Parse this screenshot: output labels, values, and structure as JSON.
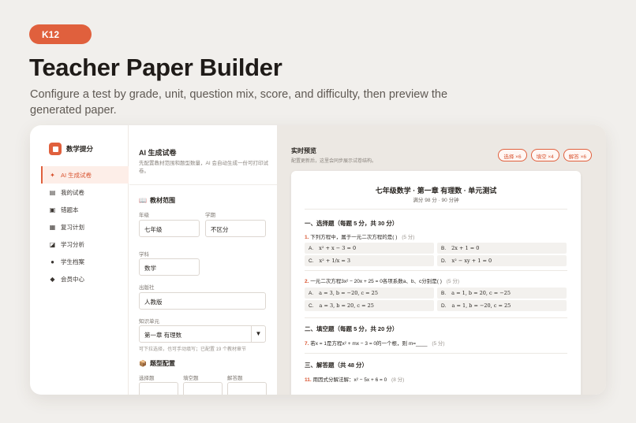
{
  "header": {
    "tag": "K12",
    "title": "Teacher Paper Builder",
    "subtitle": "Configure a test by grade, unit, question mix, score, and difficulty, then preview the generated paper."
  },
  "sidebar": {
    "brand": "数学提分",
    "items": [
      {
        "label": "AI 生成试卷",
        "icon": "sparkle-icon",
        "glyph": "✦"
      },
      {
        "label": "我的试卷",
        "icon": "document-icon",
        "glyph": "▤"
      },
      {
        "label": "错题本",
        "icon": "book-icon",
        "glyph": "▣"
      },
      {
        "label": "复习计划",
        "icon": "calendar-icon",
        "glyph": "▦"
      },
      {
        "label": "学习分析",
        "icon": "chart-icon",
        "glyph": "◪"
      },
      {
        "label": "学生档案",
        "icon": "user-icon",
        "glyph": "●"
      },
      {
        "label": "会员中心",
        "icon": "diamond-icon",
        "glyph": "◆"
      }
    ]
  },
  "form": {
    "title": "AI 生成试卷",
    "description": "先配置教材范围和题型数量，AI 会自动生成一份可打印试卷。",
    "scope_section": "教材范围",
    "grade_label": "年级",
    "grade_value": "七年级",
    "term_label": "学期",
    "term_value": "不区分",
    "subject_label": "学科",
    "subject_value": "数学",
    "publisher_label": "出版社",
    "publisher_value": "人教版",
    "unit_label": "知识单元",
    "unit_value": "第一章 有理数",
    "unit_hint": "可下拉选择，也可手动填写；已配置 19 个教材章节",
    "types_section": "题型配置",
    "type_labels": [
      "选择题",
      "填空题",
      "解答题"
    ]
  },
  "preview": {
    "title": "实时预览",
    "description": "配置更新后，这里会同步展示试卷结构。",
    "chips": [
      "选择 ×6",
      "填空 ×4",
      "解答 ×6"
    ],
    "paper": {
      "title": "七年级数学 · 第一章 有理数 · 单元测试",
      "meta": "满分 98 分 · 90 分钟",
      "sections": [
        "一、选择题（每题 5 分，共 30 分）",
        "二、填空题（每题 5 分，共 20 分）",
        "三、解答题（共 48 分）"
      ],
      "questions": [
        {
          "num": "1.",
          "text": "下列方程中，属于一元二次方程的是(        )",
          "points": "(5 分)",
          "options": [
            "A.|x² + x − 3 = 0",
            "B.|2x + 1 = 0",
            "C.|x² + 1/x = 3",
            "D.|x² − xy + 1 = 0"
          ]
        },
        {
          "num": "2.",
          "text": "一元二次方程3x² − 20x + 25 = 0各项系数a、b、c分别是(        )",
          "points": "(5 分)",
          "options": [
            "A.|a = 3, b = −20, c = 25",
            "B.|a = 1, b = 20, c = −25",
            "C.|a = 3, b = 20, c = 25",
            "D.|a = 1, b = −20, c = 25"
          ]
        },
        {
          "num": "7.",
          "text": "若x = 1是方程x² + mx − 3 = 0的一个根，则 m=____",
          "points": "(5 分)"
        },
        {
          "num": "11.",
          "text": "用因式分解法解：x² − 5x + 6 = 0",
          "points": "(8 分)"
        }
      ]
    }
  },
  "colors": {
    "accent": "#e0603d",
    "background": "#f1efec",
    "preview_bg": "#ece8e3"
  }
}
